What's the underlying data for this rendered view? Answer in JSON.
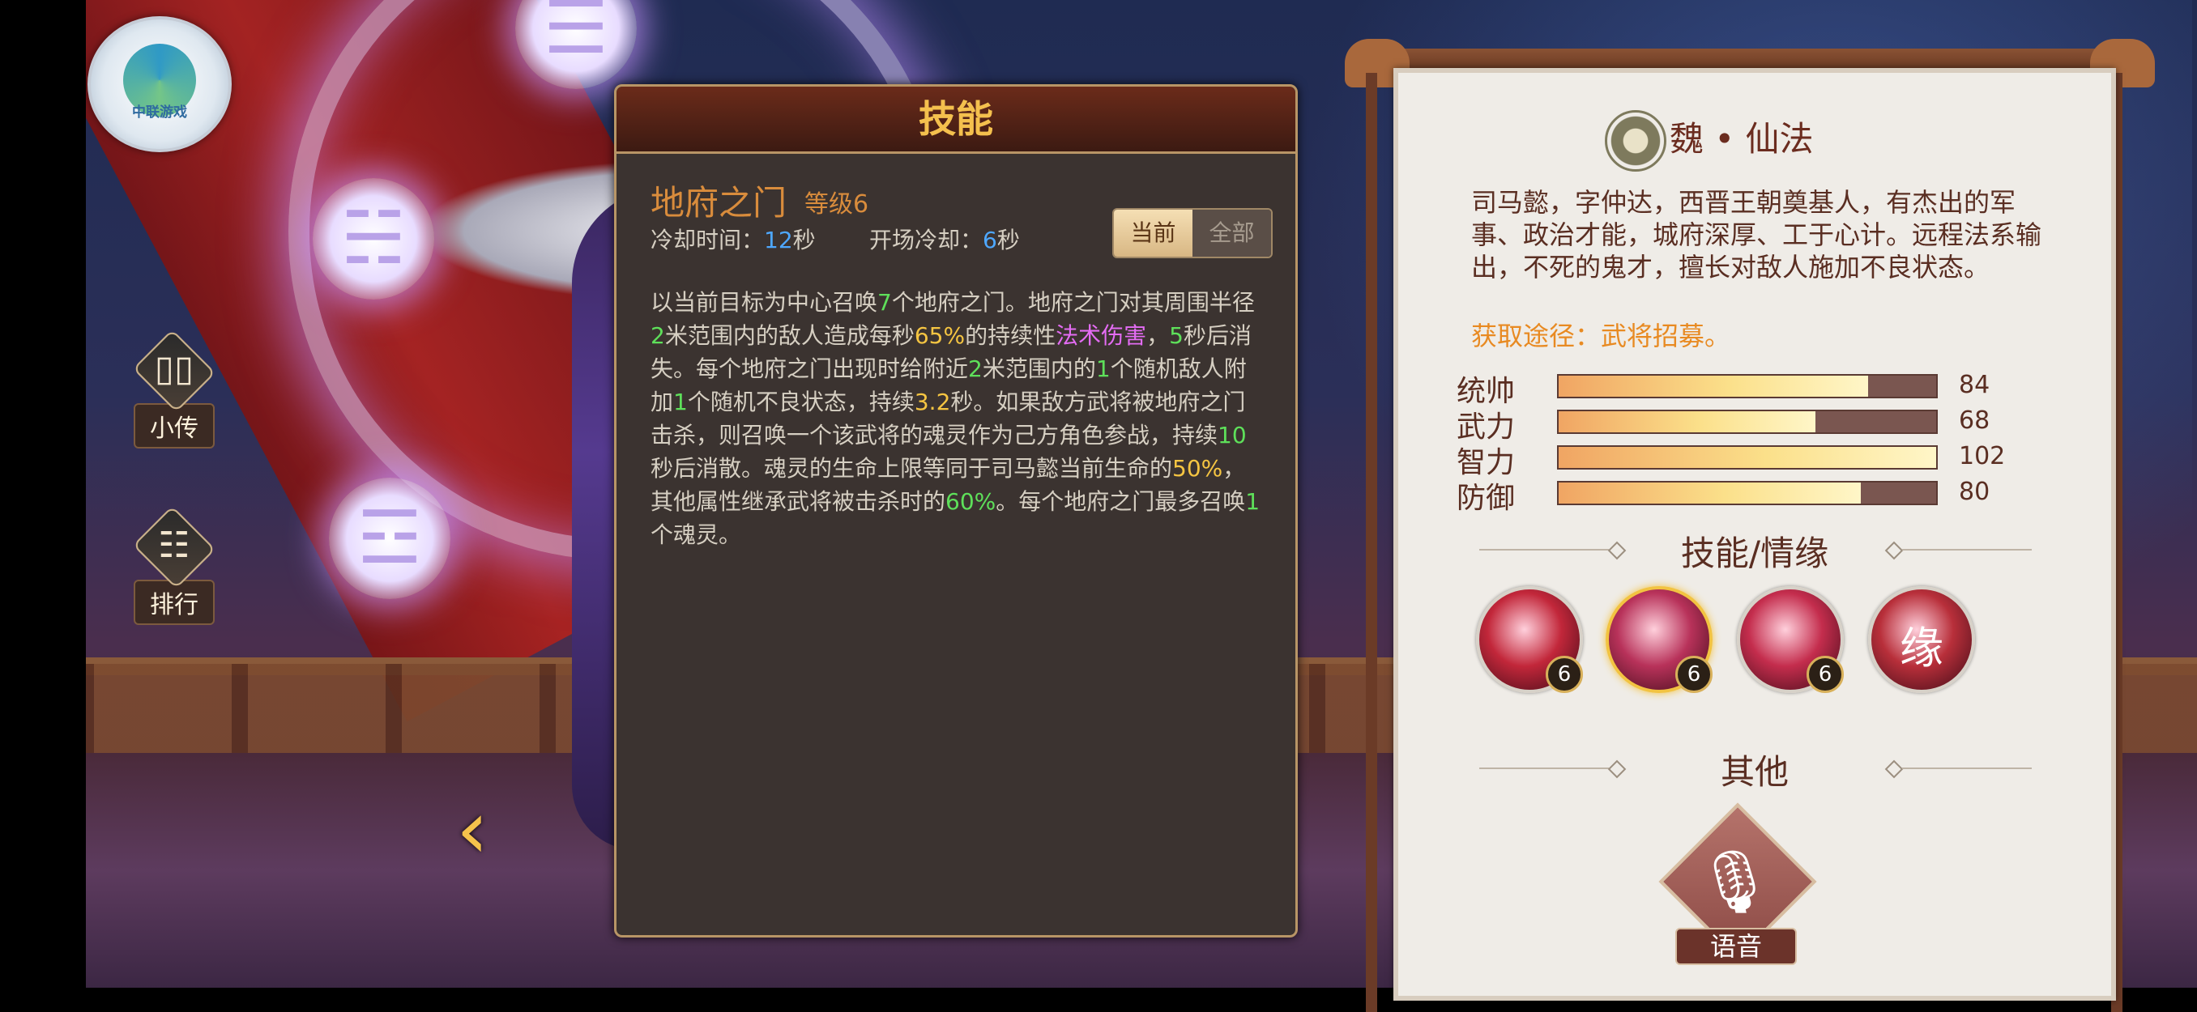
{
  "logo": {
    "text": "中联游戏"
  },
  "side_menu": [
    {
      "label": "小传",
      "icon": "biography-cards-icon"
    },
    {
      "label": "排行",
      "icon": "ranking-scroll-icon"
    }
  ],
  "skill_panel": {
    "title": "技能",
    "skill_name": "地府之门",
    "level": "等级6",
    "cooldown_label": "冷却时间：",
    "cooldown_value": "12",
    "cooldown_unit": "秒",
    "open_cooldown_label": "开场冷却：",
    "open_cooldown_value": "6",
    "open_cooldown_unit": "秒",
    "toggle": {
      "current": "当前",
      "all": "全部",
      "selected": "当前"
    },
    "description_parts": [
      {
        "t": "以当前目标为中心召唤",
        "c": ""
      },
      {
        "t": "7",
        "c": "g"
      },
      {
        "t": "个地府之门。地府之门对其周围半径",
        "c": ""
      },
      {
        "t": "2",
        "c": "g"
      },
      {
        "t": "米范围内的敌人造成每秒",
        "c": ""
      },
      {
        "t": "65%",
        "c": "y"
      },
      {
        "t": "的持续性",
        "c": ""
      },
      {
        "t": "法术伤害",
        "c": "m"
      },
      {
        "t": "，",
        "c": ""
      },
      {
        "t": "5",
        "c": "g"
      },
      {
        "t": "秒后消失。每个地府之门出现时给附近",
        "c": ""
      },
      {
        "t": "2",
        "c": "g"
      },
      {
        "t": "米范围内的",
        "c": ""
      },
      {
        "t": "1",
        "c": "g"
      },
      {
        "t": "个随机敌人附加",
        "c": ""
      },
      {
        "t": "1",
        "c": "g"
      },
      {
        "t": "个随机不良状态，持续",
        "c": ""
      },
      {
        "t": "3.2",
        "c": "y"
      },
      {
        "t": "秒。如果敌方武将被地府之门击杀，则召唤一个该武将的魂灵作为己方角色参战，持续",
        "c": ""
      },
      {
        "t": "10",
        "c": "g"
      },
      {
        "t": "秒后消散。魂灵的生命上限等同于司马懿当前生命的",
        "c": ""
      },
      {
        "t": "50%",
        "c": "y"
      },
      {
        "t": "，其他属性继承武将被击杀时的",
        "c": ""
      },
      {
        "t": "60%",
        "c": "g"
      },
      {
        "t": "。每个地府之门最多召唤",
        "c": ""
      },
      {
        "t": "1",
        "c": "g"
      },
      {
        "t": "个魂灵。",
        "c": ""
      }
    ]
  },
  "info_card": {
    "faction": "魏 • 仙法",
    "bio": "司马懿，字仲达，西晋王朝奠基人，有杰出的军事、政治才能，城府深厚、工于心计。远程法系输出，不死的鬼才，擅长对敌人施加不良状态。",
    "source": "获取途径：武将招募。",
    "stats": [
      {
        "name": "统帅",
        "value": "84",
        "fill": 0.82
      },
      {
        "name": "武力",
        "value": "68",
        "fill": 0.68
      },
      {
        "name": "智力",
        "value": "102",
        "fill": 1.0
      },
      {
        "name": "防御",
        "value": "80",
        "fill": 0.8
      }
    ],
    "skills_title": "技能/情缘",
    "skill_icons": [
      {
        "name": "skill-claw-icon",
        "level": "6",
        "selected": false,
        "color": "#c2273a"
      },
      {
        "name": "skill-ghost-gate-icon",
        "level": "6",
        "selected": true,
        "color": "#b8325a"
      },
      {
        "name": "skill-spirit-icon",
        "level": "6",
        "selected": false,
        "color": "#c42d4d"
      },
      {
        "name": "fate-icon",
        "glyph": "缘",
        "color": "#b82f3a"
      }
    ],
    "other_title": "其他",
    "voice_label": "语音"
  }
}
